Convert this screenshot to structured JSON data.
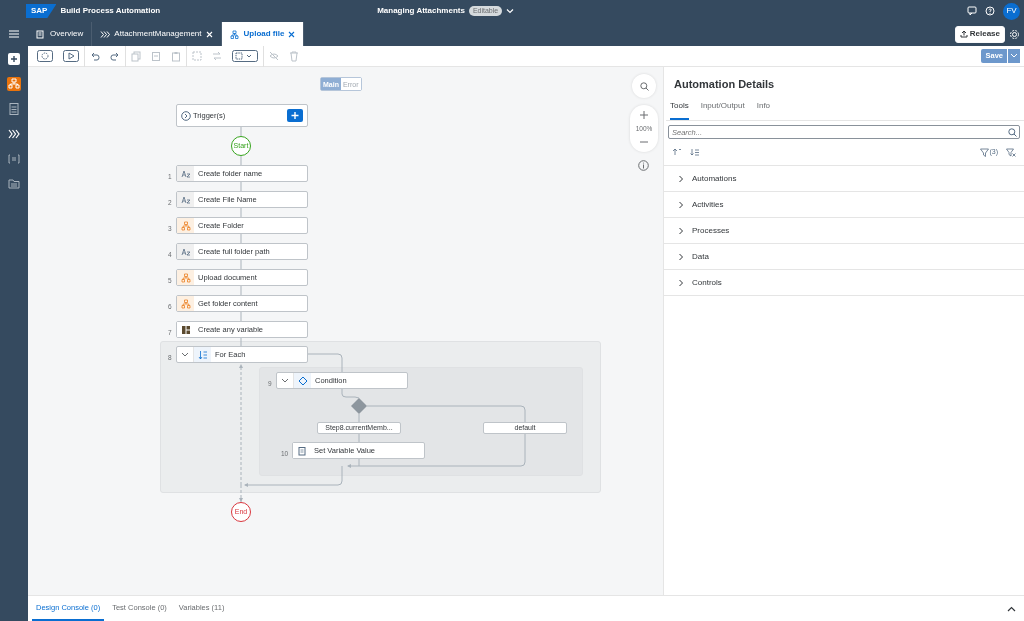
{
  "app": {
    "logo": "SAP",
    "title": "Build Process Automation",
    "project": "Managing Attachments",
    "status": "Editable",
    "avatar": "FV"
  },
  "tabs": [
    {
      "label": "Overview",
      "selected": false,
      "closable": false
    },
    {
      "label": "AttachmentManagement",
      "selected": false,
      "closable": true
    },
    {
      "label": "Upload file",
      "selected": true,
      "closable": true
    }
  ],
  "release_button": "Release",
  "save_button": {
    "label": "Save",
    "disabled": true
  },
  "sidebar": [
    {
      "selected": true
    },
    {
      "selected": false
    },
    {
      "selected": false
    },
    {
      "selected": false
    },
    {
      "selected": false
    }
  ],
  "canvas": {
    "view_toggle": [
      {
        "label": "Main",
        "selected": true
      },
      {
        "label": "Error",
        "selected": false
      }
    ],
    "trigger": "Trigger(s)",
    "start": "Start",
    "end": "End",
    "zoom": "100%",
    "steps": [
      {
        "number": "1",
        "label": "Create folder name",
        "kind": "text"
      },
      {
        "number": "2",
        "label": "Create File Name",
        "kind": "text"
      },
      {
        "number": "3",
        "label": "Create Folder",
        "kind": "automation"
      },
      {
        "number": "4",
        "label": "Create full folder path",
        "kind": "text"
      },
      {
        "number": "5",
        "label": "Upload document",
        "kind": "automation"
      },
      {
        "number": "6",
        "label": "Get folder content",
        "kind": "automation"
      },
      {
        "number": "7",
        "label": "Create any variable",
        "kind": "variable"
      },
      {
        "number": "8",
        "label": "For Each",
        "kind": "loop"
      },
      {
        "number": "9",
        "label": "Condition",
        "kind": "condition"
      },
      {
        "number": "10",
        "label": "Set Variable Value",
        "kind": "set"
      }
    ],
    "branches": [
      "Step8.currentMemb...",
      "default"
    ]
  },
  "details": {
    "title": "Automation Details",
    "tabs": [
      {
        "label": "Tools",
        "selected": true
      },
      {
        "label": "Input/Output",
        "selected": false
      },
      {
        "label": "Info",
        "selected": false
      }
    ],
    "search": {
      "placeholder": "Search..."
    },
    "filter_count": "(3)",
    "sections": [
      {
        "label": "Automations",
        "expanded": false
      },
      {
        "label": "Activities",
        "expanded": false
      },
      {
        "label": "Processes",
        "expanded": false
      },
      {
        "label": "Data",
        "expanded": false
      },
      {
        "label": "Controls",
        "expanded": false
      }
    ]
  },
  "bottom_tabs": [
    {
      "label": "Design Console (0)",
      "selected": true
    },
    {
      "label": "Test Console (0)",
      "selected": false
    },
    {
      "label": "Variables (11)",
      "selected": false
    }
  ]
}
